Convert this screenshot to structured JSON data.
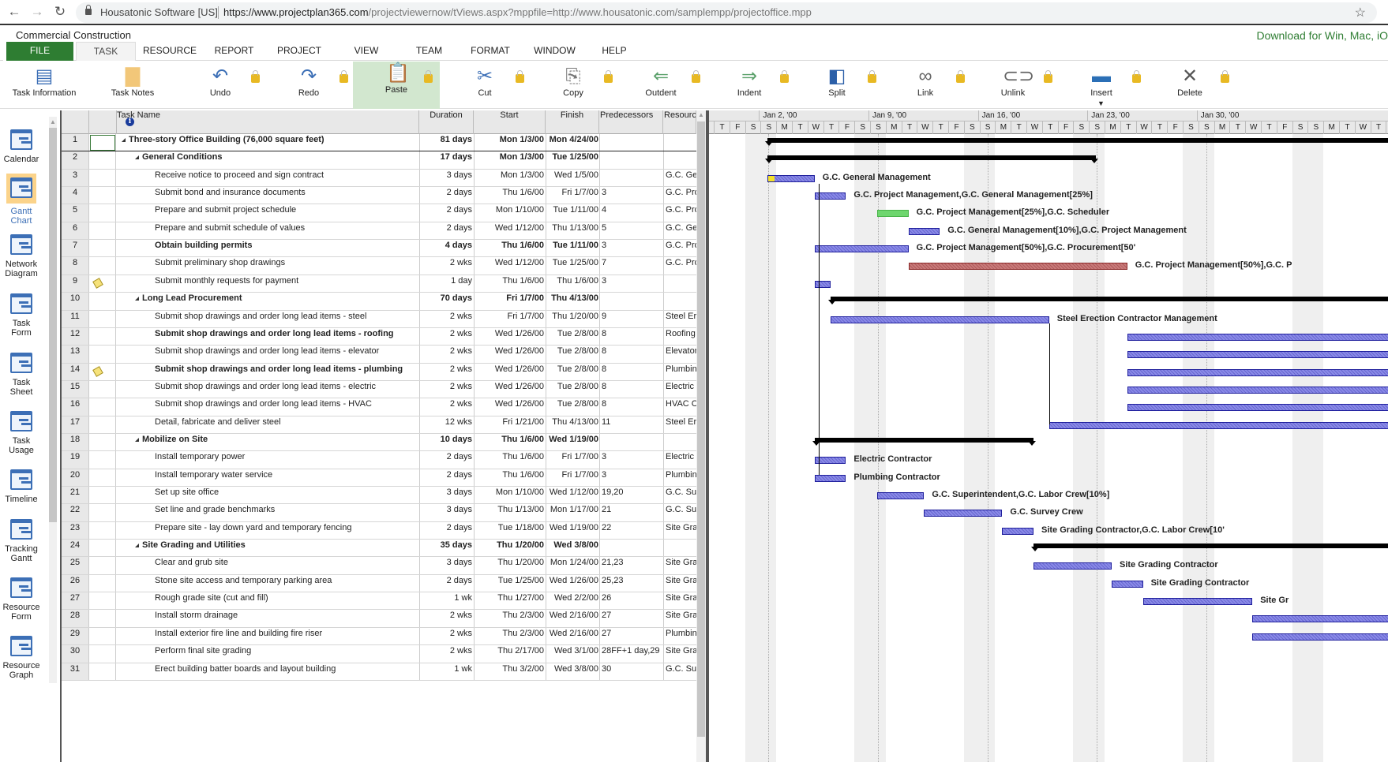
{
  "browser": {
    "site_name": "Housatonic Software [US]",
    "url_domain": "https://www.projectplan365.com",
    "url_path": "/projectviewernow/tViews.aspx?mppfile=http://www.housatonic.com/samplempp/projectoffice.mpp"
  },
  "app": {
    "title": "Commercial Construction",
    "download_link": "Download for Win, Mac, iO"
  },
  "menu": [
    "FILE",
    "TASK",
    "RESOURCE",
    "REPORT",
    "PROJECT",
    "VIEW",
    "TEAM",
    "FORMAT",
    "WINDOW",
    "HELP"
  ],
  "ribbon": [
    {
      "label": "Task Information",
      "icon": "task-information-icon",
      "locked": false
    },
    {
      "label": "Task Notes",
      "icon": "task-notes-icon",
      "locked": false
    },
    {
      "label": "Undo",
      "icon": "undo-icon",
      "locked": true
    },
    {
      "label": "Redo",
      "icon": "redo-icon",
      "locked": true
    },
    {
      "label": "Paste",
      "icon": "paste-icon",
      "locked": true
    },
    {
      "label": "Cut",
      "icon": "cut-icon",
      "locked": true
    },
    {
      "label": "Copy",
      "icon": "copy-icon",
      "locked": true
    },
    {
      "label": "Outdent",
      "icon": "outdent-icon",
      "locked": true
    },
    {
      "label": "Indent",
      "icon": "indent-icon",
      "locked": true
    },
    {
      "label": "Split",
      "icon": "split-icon",
      "locked": true
    },
    {
      "label": "Link",
      "icon": "link-icon",
      "locked": true
    },
    {
      "label": "Unlink",
      "icon": "unlink-icon",
      "locked": true
    },
    {
      "label": "Insert",
      "icon": "insert-icon",
      "locked": true
    },
    {
      "label": "Delete",
      "icon": "delete-icon",
      "locked": true
    }
  ],
  "views": [
    {
      "line1": "Calendar",
      "line2": ""
    },
    {
      "line1": "Gantt",
      "line2": "Chart",
      "active": true
    },
    {
      "line1": "Network",
      "line2": "Diagram"
    },
    {
      "line1": "Task",
      "line2": "Form"
    },
    {
      "line1": "Task",
      "line2": "Sheet"
    },
    {
      "line1": "Task",
      "line2": "Usage"
    },
    {
      "line1": "Timeline",
      "line2": ""
    },
    {
      "line1": "Tracking",
      "line2": "Gantt"
    },
    {
      "line1": "Resource",
      "line2": "Form"
    },
    {
      "line1": "Resource",
      "line2": "Graph"
    }
  ],
  "grid": {
    "headers": {
      "task_name": "Task Name",
      "duration": "Duration",
      "start": "Start",
      "finish": "Finish",
      "predecessors": "Predecessors",
      "resource": "Resource"
    },
    "rows": [
      {
        "id": "1",
        "name": "Three-story Office Building (76,000 square feet)",
        "duration": "81 days",
        "start": "Mon 1/3/00",
        "finish": "Mon 4/24/00",
        "pred": "",
        "res": "",
        "level": 0,
        "summary": true,
        "bold": true
      },
      {
        "id": "2",
        "name": "General Conditions",
        "duration": "17 days",
        "start": "Mon 1/3/00",
        "finish": "Tue 1/25/00",
        "pred": "",
        "res": "",
        "level": 1,
        "summary": true,
        "bold": true
      },
      {
        "id": "3",
        "name": "Receive notice to proceed and sign contract",
        "duration": "3 days",
        "start": "Mon 1/3/00",
        "finish": "Wed 1/5/00",
        "pred": "",
        "res": "G.C. Gen",
        "level": 2
      },
      {
        "id": "4",
        "name": "Submit bond and insurance documents",
        "duration": "2 days",
        "start": "Thu 1/6/00",
        "finish": "Fri 1/7/00",
        "pred": "3",
        "res": "G.C. Pro",
        "level": 2
      },
      {
        "id": "5",
        "name": "Prepare and submit project schedule",
        "duration": "2 days",
        "start": "Mon 1/10/00",
        "finish": "Tue 1/11/00",
        "pred": "4",
        "res": "G.C. Pro",
        "level": 2
      },
      {
        "id": "6",
        "name": "Prepare and submit schedule of values",
        "duration": "2 days",
        "start": "Wed 1/12/00",
        "finish": "Thu 1/13/00",
        "pred": "5",
        "res": "G.C. Gen",
        "level": 2
      },
      {
        "id": "7",
        "name": "Obtain building permits",
        "duration": "4 days",
        "start": "Thu 1/6/00",
        "finish": "Tue 1/11/00",
        "pred": "3",
        "res": "G.C. Pro",
        "level": 2,
        "bold": true
      },
      {
        "id": "8",
        "name": "Submit preliminary shop drawings",
        "duration": "2 wks",
        "start": "Wed 1/12/00",
        "finish": "Tue 1/25/00",
        "pred": "7",
        "res": "G.C. Pro",
        "level": 2
      },
      {
        "id": "9",
        "name": "Submit monthly requests for payment",
        "duration": "1 day",
        "start": "Thu 1/6/00",
        "finish": "Thu 1/6/00",
        "pred": "3",
        "res": "",
        "level": 2,
        "note": true
      },
      {
        "id": "10",
        "name": "Long Lead Procurement",
        "duration": "70 days",
        "start": "Fri 1/7/00",
        "finish": "Thu 4/13/00",
        "pred": "",
        "res": "",
        "level": 1,
        "summary": true,
        "bold": true
      },
      {
        "id": "11",
        "name": "Submit shop drawings and order long lead items - steel",
        "duration": "2 wks",
        "start": "Fri 1/7/00",
        "finish": "Thu 1/20/00",
        "pred": "9",
        "res": "Steel Ere",
        "level": 2
      },
      {
        "id": "12",
        "name": "Submit shop drawings and order long lead items - roofing",
        "duration": "2 wks",
        "start": "Wed 1/26/00",
        "finish": "Tue 2/8/00",
        "pred": "8",
        "res": "Roofing C",
        "level": 2,
        "bold_name": true
      },
      {
        "id": "13",
        "name": "Submit shop drawings and order long lead items - elevator",
        "duration": "2 wks",
        "start": "Wed 1/26/00",
        "finish": "Tue 2/8/00",
        "pred": "8",
        "res": "Elevator",
        "level": 2
      },
      {
        "id": "14",
        "name": "Submit shop drawings and order long lead items - plumbing",
        "duration": "2 wks",
        "start": "Wed 1/26/00",
        "finish": "Tue 2/8/00",
        "pred": "8",
        "res": "Plumbing",
        "level": 2,
        "bold_name": true,
        "note": true
      },
      {
        "id": "15",
        "name": "Submit shop drawings and order long lead items - electric",
        "duration": "2 wks",
        "start": "Wed 1/26/00",
        "finish": "Tue 2/8/00",
        "pred": "8",
        "res": "Electric C",
        "level": 2
      },
      {
        "id": "16",
        "name": "Submit shop drawings and order long lead items - HVAC",
        "duration": "2 wks",
        "start": "Wed 1/26/00",
        "finish": "Tue 2/8/00",
        "pred": "8",
        "res": "HVAC Co",
        "level": 2
      },
      {
        "id": "17",
        "name": "Detail, fabricate and deliver steel",
        "duration": "12 wks",
        "start": "Fri 1/21/00",
        "finish": "Thu 4/13/00",
        "pred": "11",
        "res": "Steel Ere",
        "level": 2
      },
      {
        "id": "18",
        "name": "Mobilize on Site",
        "duration": "10 days",
        "start": "Thu 1/6/00",
        "finish": "Wed 1/19/00",
        "pred": "",
        "res": "",
        "level": 1,
        "summary": true,
        "bold": true
      },
      {
        "id": "19",
        "name": "Install temporary power",
        "duration": "2 days",
        "start": "Thu 1/6/00",
        "finish": "Fri 1/7/00",
        "pred": "3",
        "res": "Electric C",
        "level": 2
      },
      {
        "id": "20",
        "name": "Install temporary water service",
        "duration": "2 days",
        "start": "Thu 1/6/00",
        "finish": "Fri 1/7/00",
        "pred": "3",
        "res": "Plumbing",
        "level": 2
      },
      {
        "id": "21",
        "name": "Set up site office",
        "duration": "3 days",
        "start": "Mon 1/10/00",
        "finish": "Wed 1/12/00",
        "pred": "19,20",
        "res": "G.C. Sup",
        "level": 2
      },
      {
        "id": "22",
        "name": "Set line and grade benchmarks",
        "duration": "3 days",
        "start": "Thu 1/13/00",
        "finish": "Mon 1/17/00",
        "pred": "21",
        "res": "G.C. Sur",
        "level": 2
      },
      {
        "id": "23",
        "name": "Prepare site - lay down yard and temporary fencing",
        "duration": "2 days",
        "start": "Tue 1/18/00",
        "finish": "Wed 1/19/00",
        "pred": "22",
        "res": "Site Grad",
        "level": 2
      },
      {
        "id": "24",
        "name": "Site Grading and Utilities",
        "duration": "35 days",
        "start": "Thu 1/20/00",
        "finish": "Wed 3/8/00",
        "pred": "",
        "res": "",
        "level": 1,
        "summary": true,
        "bold": true
      },
      {
        "id": "25",
        "name": "Clear and grub site",
        "duration": "3 days",
        "start": "Thu 1/20/00",
        "finish": "Mon 1/24/00",
        "pred": "21,23",
        "res": "Site Grad",
        "level": 2
      },
      {
        "id": "26",
        "name": "Stone site access and temporary parking area",
        "duration": "2 days",
        "start": "Tue 1/25/00",
        "finish": "Wed 1/26/00",
        "pred": "25,23",
        "res": "Site Grad",
        "level": 2
      },
      {
        "id": "27",
        "name": "Rough grade site (cut and fill)",
        "duration": "1 wk",
        "start": "Thu 1/27/00",
        "finish": "Wed 2/2/00",
        "pred": "26",
        "res": "Site Grad",
        "level": 2
      },
      {
        "id": "28",
        "name": "Install storm drainage",
        "duration": "2 wks",
        "start": "Thu 2/3/00",
        "finish": "Wed 2/16/00",
        "pred": "27",
        "res": "Site Grad",
        "level": 2
      },
      {
        "id": "29",
        "name": "Install exterior fire line and building fire riser",
        "duration": "2 wks",
        "start": "Thu 2/3/00",
        "finish": "Wed 2/16/00",
        "pred": "27",
        "res": "Plumbing",
        "level": 2
      },
      {
        "id": "30",
        "name": "Perform final site grading",
        "duration": "2 wks",
        "start": "Thu 2/17/00",
        "finish": "Wed 3/1/00",
        "pred": "28FF+1 day,29",
        "res": "Site Grad",
        "level": 2
      },
      {
        "id": "31",
        "name": "Erect building batter boards and layout building",
        "duration": "1 wk",
        "start": "Thu 3/2/00",
        "finish": "Wed 3/8/00",
        "pred": "30",
        "res": "G.C. Sur",
        "level": 2
      }
    ]
  },
  "gantt": {
    "weeks": [
      "Jan 2, '00",
      "Jan 9, '00",
      "Jan 16, '00",
      "Jan 23, '00",
      "Jan 30, '00"
    ],
    "days": [
      "T",
      "F",
      "S",
      "S",
      "M",
      "T",
      "W",
      "T",
      "F",
      "S",
      "S",
      "M",
      "T",
      "W",
      "T",
      "F",
      "S",
      "S",
      "M",
      "T",
      "W",
      "T",
      "F",
      "S",
      "S",
      "M",
      "T",
      "W",
      "T",
      "F",
      "S",
      "S",
      "M",
      "T",
      "W",
      "T",
      "F",
      "S",
      "S",
      "M",
      "T",
      "W",
      "T",
      "F",
      "S"
    ],
    "bars": [
      {
        "row": 1,
        "type": "summary",
        "start": 3,
        "end": 45,
        "open_right": true
      },
      {
        "row": 2,
        "type": "summary",
        "start": 3,
        "end": 24
      },
      {
        "row": 3,
        "type": "task",
        "start": 3,
        "end": 6,
        "label": "G.C. General Management",
        "milestone_start": true
      },
      {
        "row": 4,
        "type": "task",
        "start": 6,
        "end": 8,
        "label": "G.C. Project Management,G.C. General Management[25%]"
      },
      {
        "row": 5,
        "type": "task",
        "start": 10,
        "end": 12,
        "label": "G.C. Project Management[25%],G.C. Scheduler",
        "color": "green"
      },
      {
        "row": 6,
        "type": "task",
        "start": 12,
        "end": 14,
        "label": "G.C. General Management[10%],G.C. Project Management"
      },
      {
        "row": 7,
        "type": "task",
        "start": 6,
        "end": 12,
        "label": "G.C. Project Management[50%],G.C. Procurement[50'"
      },
      {
        "row": 8,
        "type": "task",
        "start": 12,
        "end": 26,
        "label": "G.C. Project Management[50%],G.C. P",
        "color": "red"
      },
      {
        "row": 9,
        "type": "task",
        "start": 6,
        "end": 7,
        "label": ""
      },
      {
        "row": 10,
        "type": "summary",
        "start": 7,
        "end": 45,
        "open_right": true
      },
      {
        "row": 11,
        "type": "task",
        "start": 7,
        "end": 21,
        "label": "Steel Erection Contractor Management"
      },
      {
        "row": 12,
        "type": "task",
        "start": 26,
        "end": 45,
        "label": ""
      },
      {
        "row": 13,
        "type": "task",
        "start": 26,
        "end": 45,
        "label": ""
      },
      {
        "row": 14,
        "type": "task",
        "start": 26,
        "end": 45,
        "label": ""
      },
      {
        "row": 15,
        "type": "task",
        "start": 26,
        "end": 45,
        "label": ""
      },
      {
        "row": 16,
        "type": "task",
        "start": 26,
        "end": 45,
        "label": ""
      },
      {
        "row": 17,
        "type": "task",
        "start": 21,
        "end": 45,
        "label": ""
      },
      {
        "row": 18,
        "type": "summary",
        "start": 6,
        "end": 20
      },
      {
        "row": 19,
        "type": "task",
        "start": 6,
        "end": 8,
        "label": "Electric Contractor"
      },
      {
        "row": 20,
        "type": "task",
        "start": 6,
        "end": 8,
        "label": "Plumbing Contractor"
      },
      {
        "row": 21,
        "type": "task",
        "start": 10,
        "end": 13,
        "label": "G.C. Superintendent,G.C. Labor Crew[10%]"
      },
      {
        "row": 22,
        "type": "task",
        "start": 13,
        "end": 18,
        "label": "G.C. Survey Crew"
      },
      {
        "row": 23,
        "type": "task",
        "start": 18,
        "end": 20,
        "label": "Site Grading Contractor,G.C. Labor Crew[10'"
      },
      {
        "row": 24,
        "type": "summary",
        "start": 20,
        "end": 45,
        "open_right": true
      },
      {
        "row": 25,
        "type": "task",
        "start": 20,
        "end": 25,
        "label": "Site Grading Contractor"
      },
      {
        "row": 26,
        "type": "task",
        "start": 25,
        "end": 27,
        "label": "Site Grading Contractor"
      },
      {
        "row": 27,
        "type": "task",
        "start": 27,
        "end": 34,
        "label": "Site Gr"
      },
      {
        "row": 28,
        "type": "task",
        "start": 34,
        "end": 45,
        "label": ""
      },
      {
        "row": 29,
        "type": "task",
        "start": 34,
        "end": 45,
        "label": ""
      }
    ]
  }
}
